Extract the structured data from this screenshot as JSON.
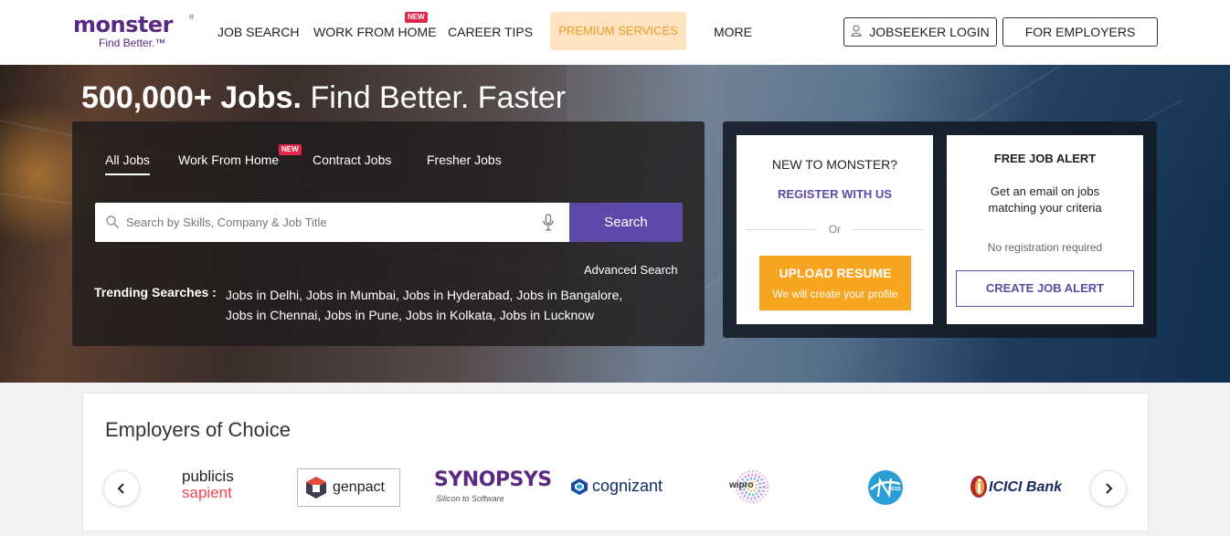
{
  "header": {
    "logo_text": "monster",
    "logo_tagline": "Find Better.™",
    "nav": {
      "job_search": "JOB SEARCH",
      "work_from_home": "WORK FROM HOME",
      "work_from_home_badge": "NEW",
      "career_tips": "CAREER TIPS",
      "premium_services": "PREMIUM SERVICES",
      "more": "MORE"
    },
    "jobseeker_login": "JOBSEEKER LOGIN",
    "for_employers": "FOR EMPLOYERS"
  },
  "hero": {
    "title_bold": "500,000+ Jobs.",
    "title_rest": " Find Better. Faster",
    "tabs": {
      "all_jobs": "All Jobs",
      "work_from_home": "Work From Home",
      "work_from_home_badge": "NEW",
      "contract_jobs": "Contract Jobs",
      "fresher_jobs": "Fresher Jobs"
    },
    "search_placeholder": "Search by Skills, Company & Job Title",
    "search_button": "Search",
    "advanced_search": "Advanced Search",
    "trending_label": "Trending Searches :",
    "trending": [
      "Jobs in Delhi",
      "Jobs in Mumbai",
      "Jobs in Hyderabad",
      "Jobs in Bangalore",
      "Jobs in Chennai",
      "Jobs in Pune",
      "Jobs in Kolkata",
      "Jobs in Lucknow"
    ]
  },
  "cta": {
    "new_to_monster": "NEW TO MONSTER?",
    "register": "REGISTER WITH US",
    "or": "Or",
    "upload_title": "UPLOAD RESUME",
    "upload_sub": "We will create your profile",
    "alert_title": "FREE JOB ALERT",
    "alert_desc": "Get an email on jobs matching your criteria",
    "alert_note": "No registration required",
    "create_alert": "CREATE JOB ALERT"
  },
  "employers": {
    "title": "Employers of Choice",
    "logos": {
      "publicis_line1": "publicis",
      "publicis_line2": "sapient",
      "genpact": "genpact",
      "synopsys": "SYNOPSYS",
      "synopsys_tag": "Silicon to Software",
      "cognizant": "cognizant",
      "wipro": "wipro",
      "ness": "NESS",
      "icici": "ICICI Bank"
    }
  },
  "colors": {
    "brand_purple": "#5e4aa8",
    "logo_purple": "#5a2a82",
    "orange": "#f7a51f",
    "badge_red": "#e0274a"
  }
}
